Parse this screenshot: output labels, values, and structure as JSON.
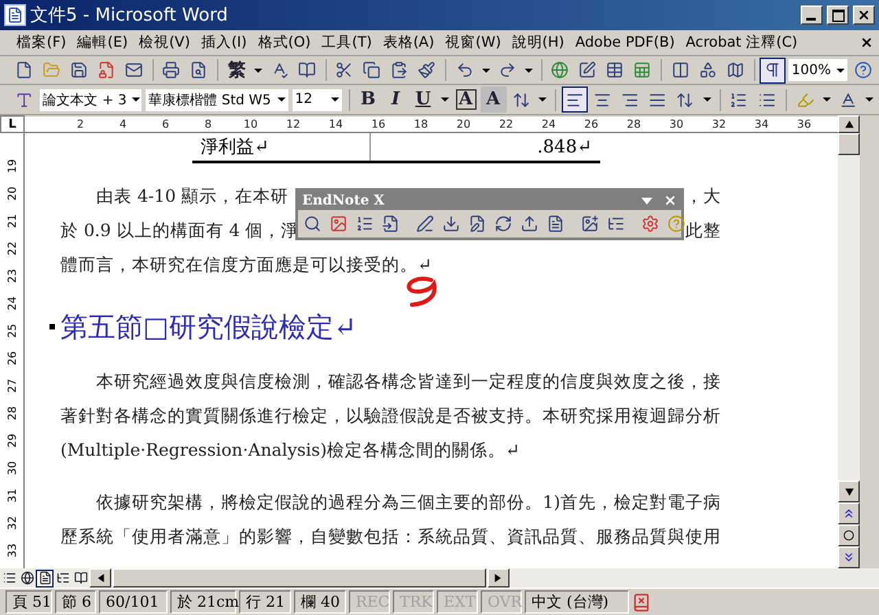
{
  "window": {
    "title": "文件5 - Microsoft Word"
  },
  "menu": [
    {
      "label": "檔案(F)"
    },
    {
      "label": "編輯(E)"
    },
    {
      "label": "檢視(V)"
    },
    {
      "label": "插入(I)"
    },
    {
      "label": "格式(O)"
    },
    {
      "label": "工具(T)"
    },
    {
      "label": "表格(A)"
    },
    {
      "label": "視窗(W)"
    },
    {
      "label": "說明(H)"
    },
    {
      "label": "Adobe PDF(B)"
    },
    {
      "label": "Acrobat 注釋(C)"
    }
  ],
  "standard_toolbar": {
    "chinese_conversion": "繁",
    "show_formatting_marks": true,
    "zoom": "100%"
  },
  "formatting_toolbar": {
    "style": "論文本文 + 3",
    "font": "華康標楷體 Std W5",
    "size": "12",
    "bold": "B",
    "italic": "I",
    "underline": "U",
    "char_border": "A",
    "char_shading": "A",
    "alignment_buttons": [
      {
        "selected": true
      },
      {
        "selected": false
      },
      {
        "selected": false
      },
      {
        "selected": false
      }
    ]
  },
  "ruler": {
    "tab_selector": "L",
    "marks": [
      "2",
      "4",
      "6",
      "8",
      "10",
      "12",
      "14",
      "16",
      "18",
      "20",
      "22",
      "24",
      "26",
      "28",
      "30",
      "32",
      "34",
      "36"
    ]
  },
  "vertical_ruler": {
    "marks": [
      "19",
      "20",
      "21",
      "22",
      "23",
      "24",
      "25",
      "26",
      "27",
      "28",
      "29",
      "30",
      "31",
      "32",
      "33"
    ]
  },
  "document": {
    "table_row": {
      "cells": [
        "淨利益↵",
        ".848↵"
      ]
    },
    "paragraphs": [
      {
        "kind": "body",
        "lines": [
          {
            "segments": [
              "由表 4-10 顯示，在本研",
              "，大"
            ]
          },
          {
            "segments": [
              "於 0.9 以上的構面有 4 個，淨",
              "此整"
            ]
          },
          {
            "segments": [
              "體而言，本研究在信度方面應是可以接受的。↵"
            ]
          }
        ]
      },
      {
        "kind": "heading",
        "lines": [
          {
            "segments": [
              "第五節□研究假說檢定↵"
            ]
          }
        ]
      },
      {
        "kind": "body",
        "lines": [
          {
            "segments": [
              "本研究經過效度與信度檢測，確認各構念皆達到一定程度的信度與效度之後，接"
            ]
          },
          {
            "segments": [
              "著針對各構念的實質關係進行檢定，以驗證假說是否被支持。本研究採用複迴歸分析"
            ]
          },
          {
            "segments": [
              "(Multiple·Regression·Analysis)檢定各構念間的關係。↵"
            ]
          }
        ]
      },
      {
        "kind": "body",
        "lines": [
          {
            "segments": [
              "依據研究架構，將檢定假說的過程分為三個主要的部份。1)首先，檢定對電子病"
            ]
          },
          {
            "segments": [
              "歷系統「使用者滿意」的影響，自變數包括：系統品質、資訊品質、服務品質與使用"
            ]
          }
        ]
      }
    ]
  },
  "endnote_toolbar": {
    "title": "EndNote X"
  },
  "view_buttons": [
    {
      "selected": false
    },
    {
      "selected": false
    },
    {
      "selected": true
    },
    {
      "selected": false
    },
    {
      "selected": false
    }
  ],
  "status_bar": {
    "page": "頁 51",
    "section": "節 6",
    "page_count": "60/101",
    "position": "於 21cm",
    "line": "行 21",
    "column": "欄 40",
    "indicators": [
      {
        "label": "REC",
        "on": false
      },
      {
        "label": "TRK",
        "on": false
      },
      {
        "label": "EXT",
        "on": false
      },
      {
        "label": "OVR",
        "on": false
      }
    ],
    "language": "中文 (台灣)"
  }
}
